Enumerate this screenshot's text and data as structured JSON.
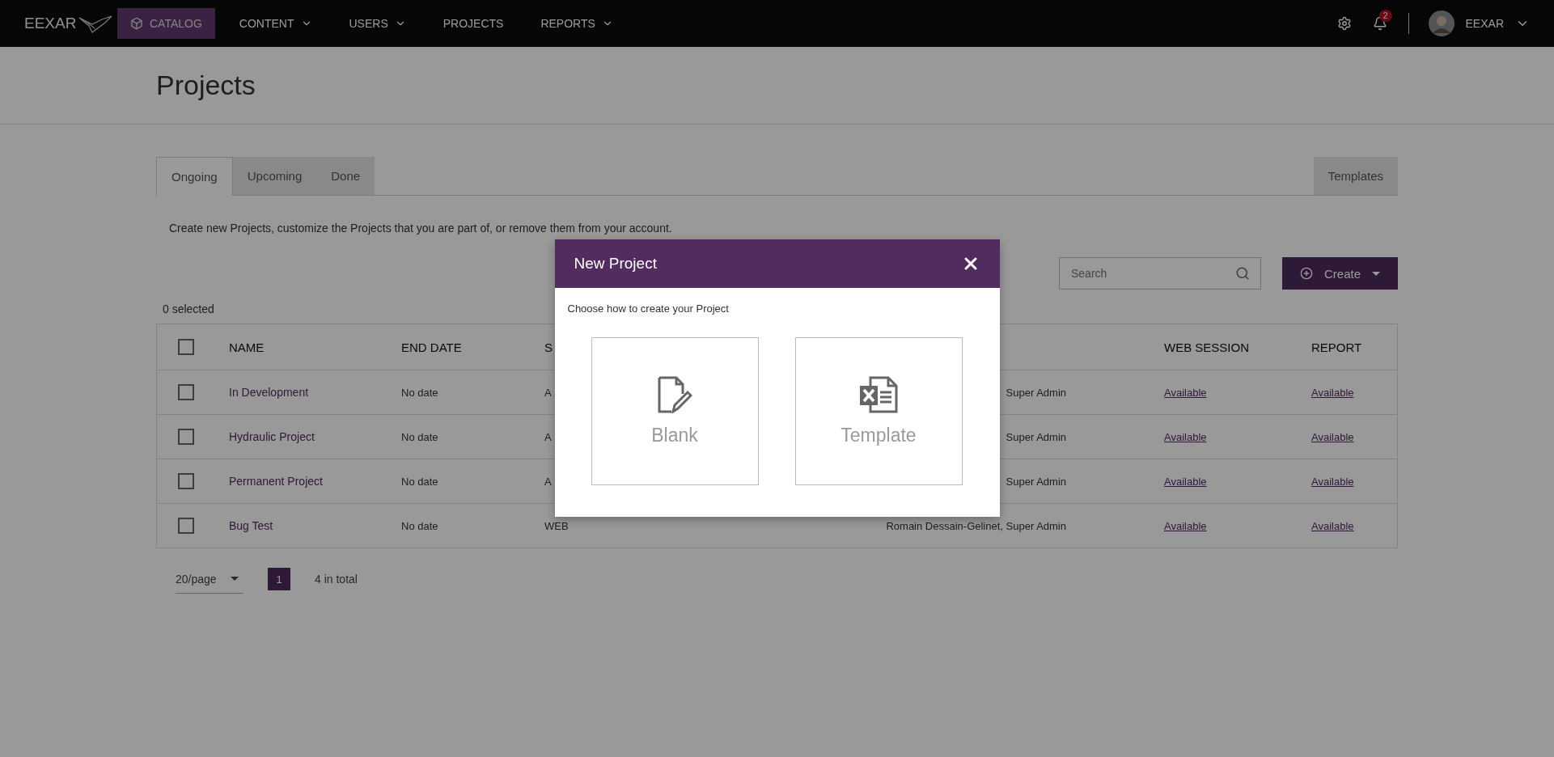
{
  "nav": {
    "logo": "EEXAR",
    "items": [
      {
        "label": "CATALOG",
        "selected": true,
        "dropdown": false
      },
      {
        "label": "CONTENT",
        "selected": false,
        "dropdown": true
      },
      {
        "label": "USERS",
        "selected": false,
        "dropdown": true
      },
      {
        "label": "PROJECTS",
        "selected": false,
        "dropdown": false
      },
      {
        "label": "REPORTS",
        "selected": false,
        "dropdown": true
      }
    ],
    "notifications": "2",
    "user": "EEXAR"
  },
  "page": {
    "title": "Projects"
  },
  "tabs": [
    {
      "label": "Ongoing",
      "selected": true
    },
    {
      "label": "Upcoming",
      "selected": false
    },
    {
      "label": "Done",
      "selected": false
    }
  ],
  "side_tab": {
    "label": "Templates",
    "selected": false
  },
  "description": "Create new Projects, customize the Projects that you are part of, or remove them from your account.",
  "search": {
    "placeholder": "Search"
  },
  "create_button": "Create",
  "selection_count": "0 selected",
  "table": {
    "header": {
      "checked": false,
      "name": "NAME",
      "end_date": "END DATE",
      "column_3": "S",
      "web_session": "WEB SESSION",
      "report": "REPORT"
    },
    "rows": [
      {
        "checked": false,
        "name": "In Development",
        "end_date": "No date",
        "column_3": "A",
        "column_4": "Super Admin",
        "web_session": "Available",
        "report": "Available"
      },
      {
        "checked": false,
        "name": "Hydraulic Project",
        "end_date": "No date",
        "column_3": "A",
        "column_4": "Super Admin",
        "web_session": "Available",
        "report": "Available"
      },
      {
        "checked": false,
        "name": "Permanent Project",
        "end_date": "No date",
        "column_3": "A",
        "column_4": "Super Admin",
        "web_session": "Available",
        "report": "Available"
      },
      {
        "checked": false,
        "name": "Bug Test",
        "end_date": "No date",
        "column_3": "WEB",
        "column_4": "Romain Dessain-Gelinet, Super Admin",
        "web_session": "Available",
        "report": "Available"
      }
    ]
  },
  "pagination": {
    "page_size": "20/page",
    "pages": [
      {
        "label": "1",
        "selected": true
      }
    ],
    "total": "4 in total"
  },
  "modal": {
    "title": "New Project",
    "prompt": "Choose how to create your Project",
    "options": [
      {
        "kind": "blank",
        "label": "Blank"
      },
      {
        "kind": "template",
        "label": "Template"
      }
    ]
  }
}
